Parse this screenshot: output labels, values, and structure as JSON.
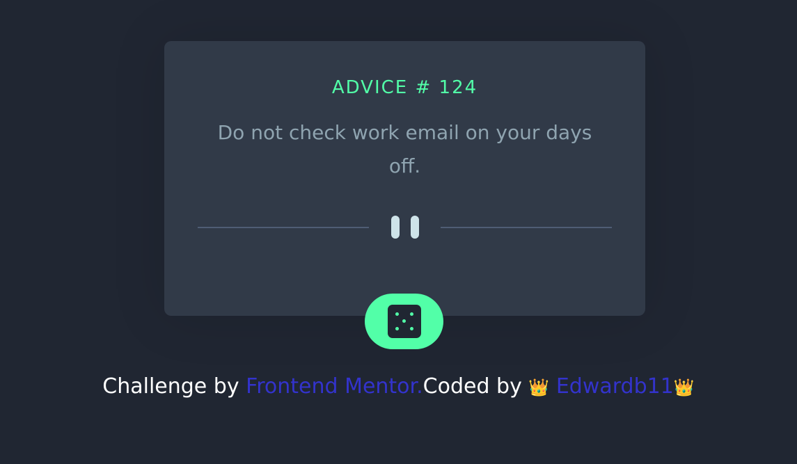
{
  "advice": {
    "label": "ADVICE # 124",
    "text": "Do not check work email on your days off."
  },
  "divider": {
    "icon": "pause-icon"
  },
  "generate_button": {
    "icon": "dice-icon"
  },
  "footer": {
    "prefix": "Challenge by ",
    "link_1": "Frontend Mentor.",
    "middle": "Coded by ",
    "crown_left": "👑",
    "link_2": "Edwardb11",
    "crown_right": "👑"
  },
  "colors": {
    "background": "#202632",
    "card": "#313a48",
    "accent": "#52ffa8",
    "text_muted": "#8fa4b0",
    "link": "#3333cc"
  }
}
